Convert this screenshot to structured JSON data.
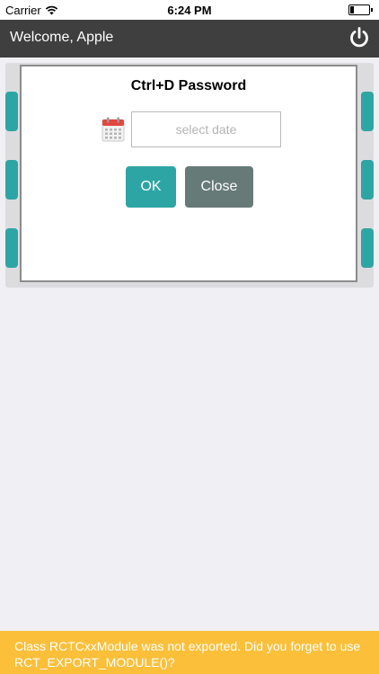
{
  "status_bar": {
    "carrier": "Carrier",
    "time": "6:24 PM",
    "battery_level": 0.2
  },
  "header": {
    "title": "Welcome, Apple",
    "power_icon": "power-icon"
  },
  "modal": {
    "title": "Ctrl+D Password",
    "calendar_icon": "calendar-icon",
    "date_input": {
      "value": "",
      "placeholder": "select date"
    },
    "ok_label": "OK",
    "close_label": "Close"
  },
  "warning": {
    "message": "Class RCTCxxModule was not exported. Did you forget to use RCT_EXPORT_MODULE()?"
  },
  "colors": {
    "header_bg": "#3f3f3f",
    "accent": "#2ea5a5",
    "close_button": "#667a78",
    "warning_bg": "#fbbf3a"
  }
}
